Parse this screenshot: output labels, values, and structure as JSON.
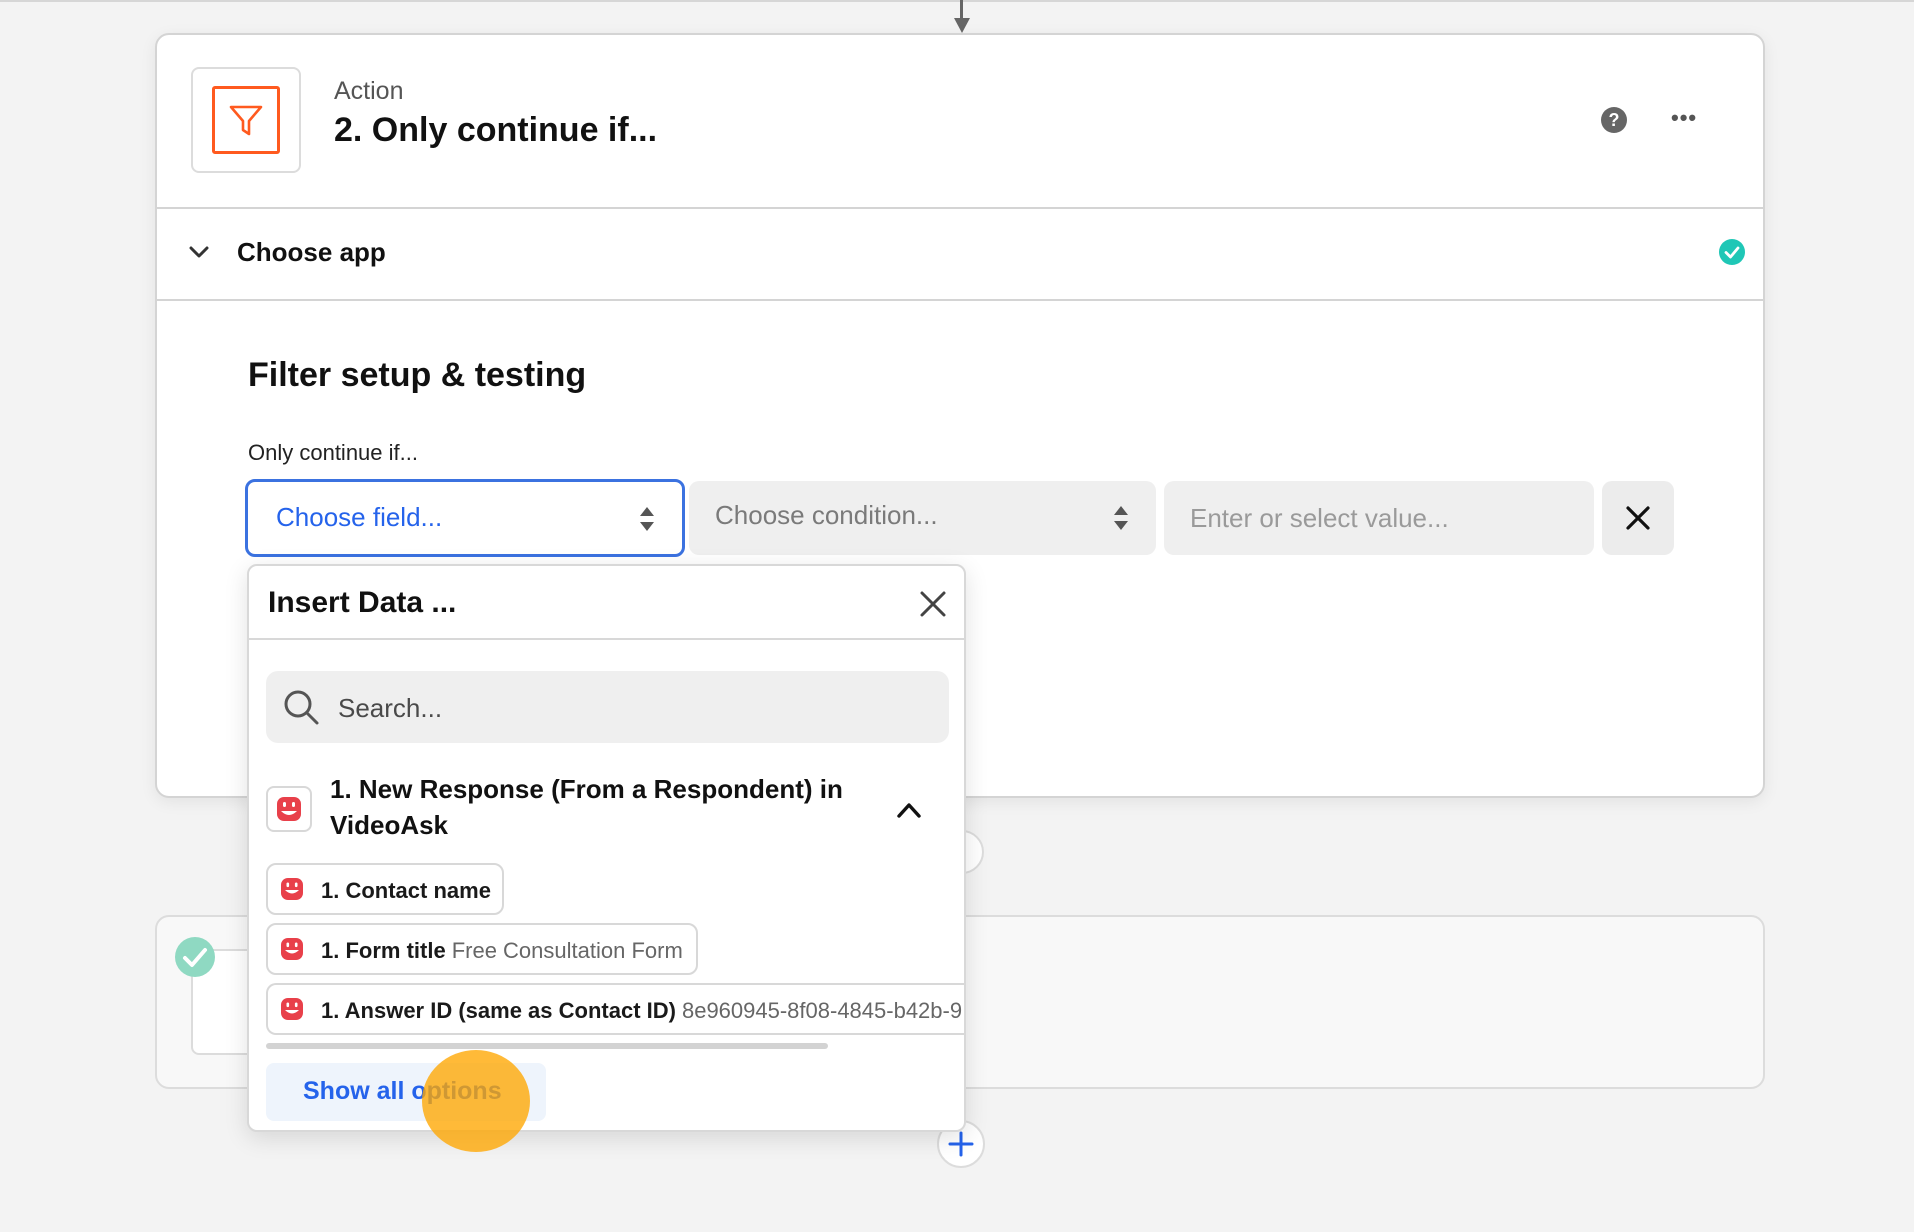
{
  "colors": {
    "accent_blue": "#2563eb",
    "filter_orange": "#ff5a1f",
    "success_teal": "#1fc7b6",
    "videoask_red": "#e8404a",
    "cursor_highlight": "#ffa600"
  },
  "step": {
    "kind": "Action",
    "title": "2. Only continue if...",
    "app_icon": "filter-icon",
    "help_icon": "help-icon",
    "more_icon": "more-horizontal-icon"
  },
  "choose_app": {
    "label": "Choose app",
    "status": "complete"
  },
  "filter": {
    "heading": "Filter setup & testing",
    "rule_label": "Only continue if...",
    "field_placeholder": "Choose field...",
    "condition_placeholder": "Choose condition...",
    "value_placeholder": "Enter or select value..."
  },
  "insert_data": {
    "title": "Insert Data ...",
    "search_placeholder": "Search...",
    "group_title": "1. New Response (From a Respondent) in VideoAsk",
    "items": [
      {
        "label": "1. Contact name",
        "value": ""
      },
      {
        "label": "1. Form title",
        "value": "Free Consultation Form"
      },
      {
        "label": "1. Answer ID (same as Contact ID)",
        "value": "8e960945-8f08-4845-b42b-9"
      }
    ],
    "show_all_label": "Show all options"
  }
}
